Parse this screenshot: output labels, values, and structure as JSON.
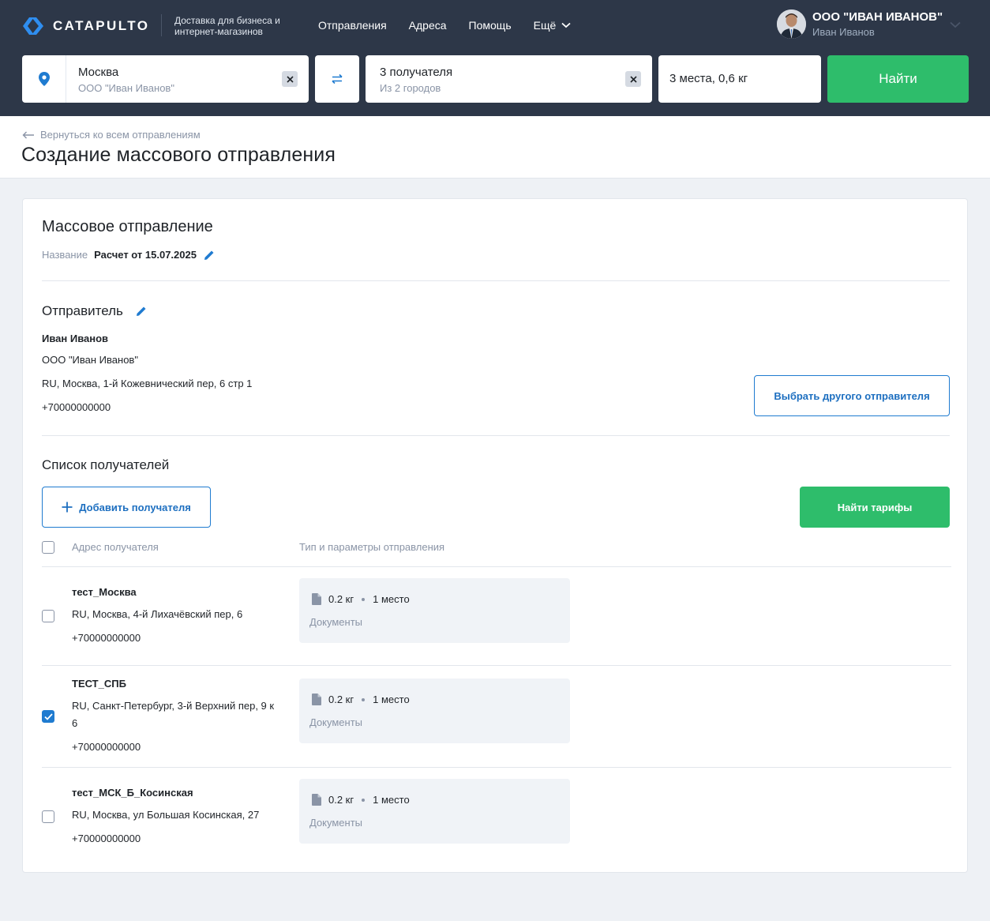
{
  "header": {
    "logo_text": "CATAPULTO",
    "tagline": "Доставка для бизнеса и интернет-магазинов",
    "nav": [
      "Отправления",
      "Адреса",
      "Помощь",
      "Ещё"
    ],
    "user": {
      "company": "ООО \"ИВАН ИВАНОВ\"",
      "name": "Иван Иванов"
    }
  },
  "search": {
    "from": {
      "city": "Москва",
      "company": "ООО \"Иван Иванов\""
    },
    "to": {
      "main": "3 получателя",
      "sub": "Из 2 городов"
    },
    "cargo": "3 места, 0,6 кг",
    "find_label": "Найти"
  },
  "page": {
    "back_label": "Вернуться ко всем отправлениям",
    "title": "Создание массового отправления"
  },
  "shipment": {
    "title": "Массовое отправление",
    "name_label": "Название",
    "name_value": "Расчет от 15.07.2025"
  },
  "sender": {
    "title": "Отправитель",
    "name": "Иван Иванов",
    "company": "ООО \"Иван Иванов\"",
    "address": "RU, Москва, 1-й Кожевнический пер, 6 стр 1",
    "phone": "+70000000000",
    "change_label": "Выбрать другого отправителя"
  },
  "recipients": {
    "title": "Список получателей",
    "add_label": "Добавить получателя",
    "find_tariffs_label": "Найти тарифы",
    "col_address": "Адрес получателя",
    "col_params": "Тип и параметры отправления",
    "rows": [
      {
        "name": "тест_Москва",
        "address": "RU, Москва, 4-й Лихачёвский пер, 6",
        "phone": "+70000000000",
        "weight": "0.2 кг",
        "places": "1 место",
        "type": "Документы",
        "checked": false
      },
      {
        "name": "ТЕСТ_СПБ",
        "address": "RU, Санкт-Петербург, 3-й Верхний пер, 9 к 6",
        "phone": "+70000000000",
        "weight": "0.2 кг",
        "places": "1 место",
        "type": "Документы",
        "checked": true
      },
      {
        "name": "тест_МСК_Б_Косинская",
        "address": "RU, Москва, ул Большая Косинская, 27",
        "phone": "+70000000000",
        "weight": "0.2 кг",
        "places": "1 место",
        "type": "Документы",
        "checked": false
      }
    ]
  },
  "colors": {
    "header_bg": "#2d3748",
    "accent_green": "#2ebd6b",
    "accent_blue": "#1f7bd0"
  }
}
